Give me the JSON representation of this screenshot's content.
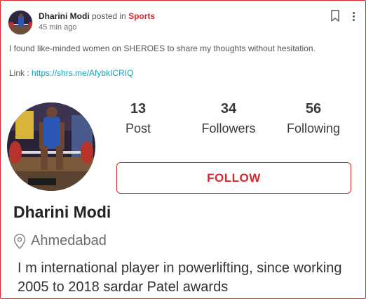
{
  "post": {
    "author_name": "Dharini Modi",
    "posted_in_text": "posted in",
    "category": "Sports",
    "timestamp": "45 min ago",
    "body_text": "I found like-minded women on SHEROES to share my thoughts without hesitation.",
    "link_label": "Link :",
    "link_url": "https://shrs.me/AfybkICRIQ",
    "icons": {
      "bookmark": "bookmark-icon",
      "more": "more-vertical-icon"
    }
  },
  "profile": {
    "stats": [
      {
        "value": "13",
        "label": "Post"
      },
      {
        "value": "34",
        "label": "Followers"
      },
      {
        "value": "56",
        "label": "Following"
      }
    ],
    "follow_label": "FOLLOW",
    "name": "Dharini Modi",
    "location": "Ahmedabad",
    "bio": "I m international player in powerlifting, since working 2005 to 2018 sardar Patel awards",
    "colors": {
      "accent": "#d9262f",
      "link": "#17a2b8"
    }
  }
}
